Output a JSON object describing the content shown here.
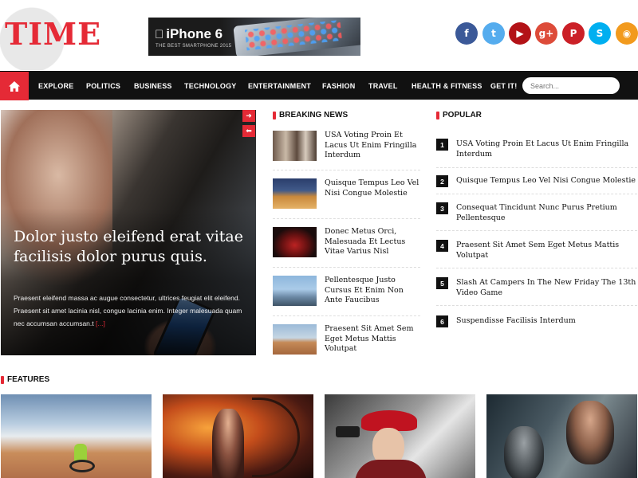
{
  "logo": {
    "text": "TIME"
  },
  "ad": {
    "title": "iPhone 6",
    "subtitle": "THE BEST SMARTPHONE 2015"
  },
  "social": [
    {
      "name": "facebook-icon",
      "glyph": "f",
      "color": "#3b5998"
    },
    {
      "name": "twitter-icon",
      "glyph": "t",
      "color": "#55acee"
    },
    {
      "name": "youtube-icon",
      "glyph": "▶",
      "color": "#b31217"
    },
    {
      "name": "googleplus-icon",
      "glyph": "g+",
      "color": "#dd4b39"
    },
    {
      "name": "pinterest-icon",
      "glyph": "P",
      "color": "#cb2027"
    },
    {
      "name": "skype-icon",
      "glyph": "S",
      "color": "#00aff0"
    },
    {
      "name": "rss-icon",
      "glyph": "◉",
      "color": "#f29a1d"
    }
  ],
  "nav": {
    "items": [
      "EXPLORE",
      "POLITICS",
      "BUSINESS",
      "TECHNOLOGY",
      "ENTERTAINMENT",
      "FASHION",
      "TRAVEL",
      "HEALTH & FITNESS",
      "GET IT!"
    ],
    "search_placeholder": "Search..."
  },
  "featured": {
    "title": "Dolor justo eleifend erat vitae facilisis dolor purus quis.",
    "excerpt": "Praesent eleifend massa ac augue consectetur, ultrices feugiat elit eleifend. Praesent sit amet lacinia nisl, congue lacinia enim. Integer malesuada quam nec accumsan accumsan.t",
    "more": "[...]"
  },
  "breaking_news": {
    "heading": "BREAKING NEWS",
    "items": [
      {
        "title": "USA Voting Proin Et Lacus Ut Enim Fringilla Interdum"
      },
      {
        "title": "Quisque Tempus Leo Vel Nisi Congue Molestie"
      },
      {
        "title": "Donec Metus Orci, Malesuada Et Lectus Vitae Varius Nisl"
      },
      {
        "title": "Pellentesque Justo Cursus Et Enim Non Ante Faucibus"
      },
      {
        "title": "Praesent Sit Amet Sem Eget Metus Mattis Volutpat"
      }
    ]
  },
  "popular": {
    "heading": "POPULAR",
    "items": [
      {
        "num": "1",
        "title": "USA Voting Proin Et Lacus Ut Enim Fringilla Interdum"
      },
      {
        "num": "2",
        "title": "Quisque Tempus Leo Vel Nisi Congue Molestie"
      },
      {
        "num": "3",
        "title": "Consequat Tincidunt Nunc Purus Pretium Pellentesque"
      },
      {
        "num": "4",
        "title": "Praesent Sit Amet Sem Eget Metus Mattis Volutpat"
      },
      {
        "num": "5",
        "title": "Slash At Campers In The New Friday The 13th Video Game"
      },
      {
        "num": "6",
        "title": "Suspendisse Facilisis Interdum"
      }
    ]
  },
  "features": {
    "heading": "FEATURES"
  },
  "colors": {
    "accent": "#e52a36",
    "nav_bg": "#111111"
  }
}
